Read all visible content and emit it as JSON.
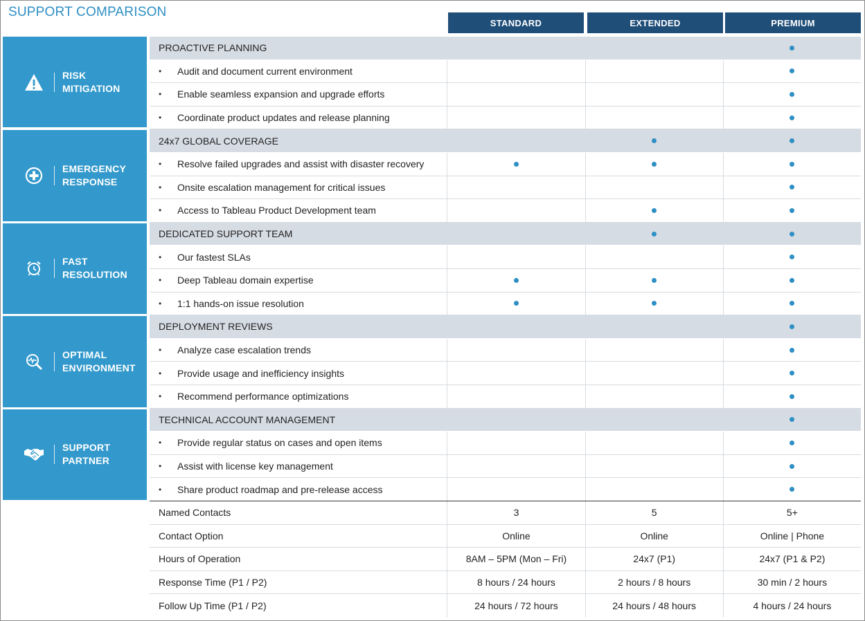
{
  "title": "SUPPORT COMPARISON",
  "columns": [
    "STANDARD",
    "EXTENDED",
    "PREMIUM"
  ],
  "accent_color": "#3399cc",
  "header_color": "#1f4e79",
  "categories": [
    {
      "label": "RISK\nMITIGATION",
      "icon": "warning-icon"
    },
    {
      "label": "EMERGENCY\nRESPONSE",
      "icon": "medical-plus-icon"
    },
    {
      "label": "FAST\nRESOLUTION",
      "icon": "alarm-clock-icon"
    },
    {
      "label": "OPTIMAL\nENVIRONMENT",
      "icon": "magnifier-pulse-icon"
    },
    {
      "label": "SUPPORT\nPARTNER",
      "icon": "handshake-icon"
    }
  ],
  "feature_rows": [
    {
      "text": "PROACTIVE PLANNING",
      "header": true,
      "marks": [
        false,
        false,
        true
      ]
    },
    {
      "text": "Audit and document current environment",
      "header": false,
      "marks": [
        false,
        false,
        true
      ]
    },
    {
      "text": "Enable seamless expansion and upgrade efforts",
      "header": false,
      "marks": [
        false,
        false,
        true
      ]
    },
    {
      "text": "Coordinate product updates and release planning",
      "header": false,
      "marks": [
        false,
        false,
        true
      ]
    },
    {
      "text": "24x7 GLOBAL COVERAGE",
      "header": true,
      "marks": [
        false,
        true,
        true
      ]
    },
    {
      "text": "Resolve failed upgrades and assist with disaster recovery",
      "header": false,
      "marks": [
        true,
        true,
        true
      ]
    },
    {
      "text": "Onsite escalation management for critical issues",
      "header": false,
      "marks": [
        false,
        false,
        true
      ]
    },
    {
      "text": "Access to Tableau Product Development team",
      "header": false,
      "marks": [
        false,
        true,
        true
      ]
    },
    {
      "text": "DEDICATED SUPPORT TEAM",
      "header": true,
      "marks": [
        false,
        true,
        true
      ]
    },
    {
      "text": "Our fastest SLAs",
      "header": false,
      "marks": [
        false,
        false,
        true
      ]
    },
    {
      "text": "Deep Tableau domain expertise",
      "header": false,
      "marks": [
        true,
        true,
        true
      ]
    },
    {
      "text": "1:1 hands-on issue resolution",
      "header": false,
      "marks": [
        true,
        true,
        true
      ]
    },
    {
      "text": "DEPLOYMENT REVIEWS",
      "header": true,
      "marks": [
        false,
        false,
        true
      ]
    },
    {
      "text": "Analyze case escalation trends",
      "header": false,
      "marks": [
        false,
        false,
        true
      ]
    },
    {
      "text": "Provide usage and inefficiency insights",
      "header": false,
      "marks": [
        false,
        false,
        true
      ]
    },
    {
      "text": "Recommend performance optimizations",
      "header": false,
      "marks": [
        false,
        false,
        true
      ]
    },
    {
      "text": "TECHNICAL ACCOUNT MANAGEMENT",
      "header": true,
      "marks": [
        false,
        false,
        true
      ]
    },
    {
      "text": "Provide regular status on cases and open items",
      "header": false,
      "marks": [
        false,
        false,
        true
      ]
    },
    {
      "text": "Assist with license key management",
      "header": false,
      "marks": [
        false,
        false,
        true
      ]
    },
    {
      "text": "Share product roadmap and pre-release access",
      "header": false,
      "marks": [
        false,
        false,
        true
      ]
    }
  ],
  "bullet": "•",
  "summary_rows": [
    {
      "label": "Named Contacts",
      "values": [
        "3",
        "5",
        "5+"
      ]
    },
    {
      "label": "Contact Option",
      "values": [
        "Online",
        "Online",
        "Online | Phone"
      ]
    },
    {
      "label": "Hours of Operation",
      "values": [
        "8AM – 5PM (Mon – Fri)",
        "24x7 (P1)",
        "24x7 (P1 & P2)"
      ]
    },
    {
      "label": "Response Time (P1 / P2)",
      "values": [
        "8 hours / 24 hours",
        "2 hours / 8 hours",
        "30 min / 2 hours"
      ]
    },
    {
      "label": "Follow Up Time (P1 / P2)",
      "values": [
        "24 hours / 72 hours",
        "24 hours / 48 hours",
        "4 hours / 24 hours"
      ]
    }
  ]
}
